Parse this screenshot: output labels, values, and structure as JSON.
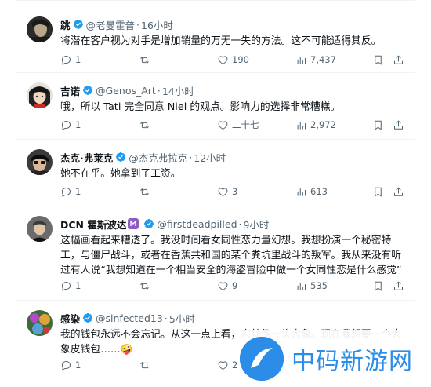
{
  "tweets": [
    {
      "name": "跳",
      "handle": "@老曼霍普",
      "time": "16小时",
      "text": "将潜在客户视为对手是增加销量的万无一失的方法。这不可能适得其反。",
      "replies": "1",
      "retweets": "",
      "likes": "190",
      "views": "7,437"
    },
    {
      "name": "吉诺",
      "handle": "@Genos_Art",
      "time": "14小时",
      "text": "哦，所以 Tati 完全同意 Niel 的观点。影响力的选择非常糟糕。",
      "replies": "1",
      "retweets": "",
      "likes": "二十七",
      "views": "2,972"
    },
    {
      "name": "杰克·弗莱克",
      "handle": "@杰克弗拉克",
      "time": "12小时",
      "text": "她不在乎。她拿到了工资。",
      "replies": "1",
      "retweets": "",
      "likes": "3",
      "views": "613"
    },
    {
      "name": "DCN 霍斯波达",
      "handle": "@firstdeadpilled",
      "time": "9小时",
      "text": "这幅画看起来糟透了。我没时间看女同性恋力量幻想。我想扮演一个秘密特工，与僵尸战斗，或者在香蕉共和国的某个粪坑里战斗的叛军。我从来没有听过有人说“我想知道在一个相当安全的海盗冒险中做一个女同性恋是什么感觉”",
      "replies": "1",
      "retweets": "",
      "likes": "9",
      "views": "535"
    },
    {
      "name": "感染",
      "handle": "@sinfected13",
      "time": "5小时",
      "text": "我的钱包永远不会忘记。从这一点上看，它就像一头大象。现在我想要一个大象皮钱包……🤪",
      "replies": "1",
      "retweets": "",
      "likes": "2",
      "views": ""
    }
  ],
  "watermark": {
    "text": "中码新游网"
  },
  "colors": {
    "verified": "#1d9bf0",
    "muted": "#536471",
    "watermark": "#2b8de8"
  }
}
